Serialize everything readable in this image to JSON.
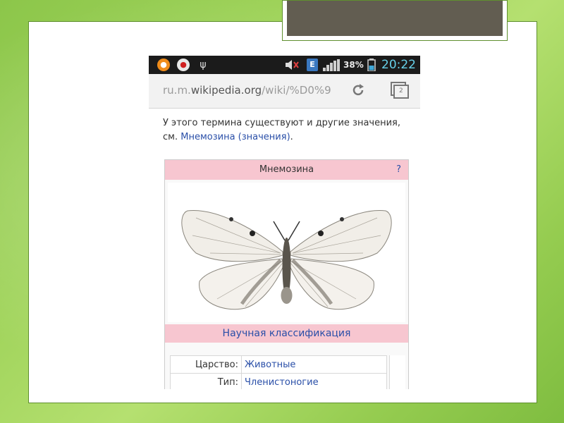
{
  "status_bar": {
    "battery": "38%",
    "time": "20:22"
  },
  "address_bar": {
    "url_prefix": "ru.m.",
    "url_domain": "wikipedia.org",
    "url_path": "/wiki/%D0%9",
    "tab_count": "2"
  },
  "article": {
    "intro_text": "У этого термина существуют и другие значения, см. ",
    "intro_link": "Мнемозина (значения)",
    "intro_end": "."
  },
  "infobox": {
    "title": "Мнемозина",
    "help": "?",
    "section": "Научная классификация",
    "rows": [
      {
        "key": "Царство:",
        "value": "Животные"
      },
      {
        "key": "Тип:",
        "value": "Членистоногие"
      }
    ]
  },
  "colors": {
    "slide_green": "#9fd35a",
    "infobox_pink": "#f7c6d0",
    "link_blue": "#2a4fa8",
    "clock_cyan": "#66d0e8",
    "dark_box": "#625d51"
  },
  "icons": [
    "app-orange-icon",
    "app-red-icon",
    "usb-icon",
    "volume-icon",
    "data-e-icon",
    "signal-icon",
    "battery-icon",
    "reload-icon",
    "tabs-icon"
  ]
}
